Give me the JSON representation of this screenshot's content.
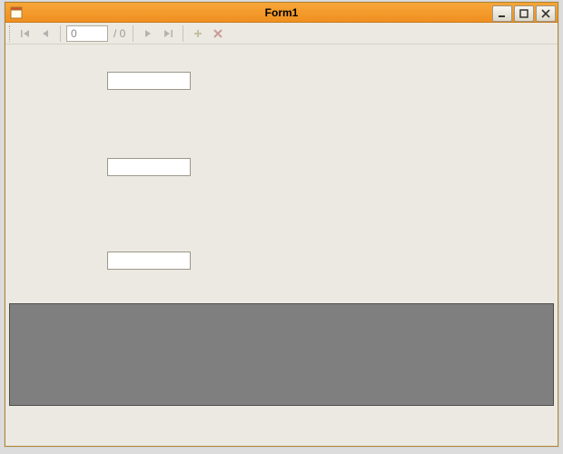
{
  "window": {
    "title": "Form1"
  },
  "navigator": {
    "position": "0",
    "total": "/ 0"
  },
  "fields": {
    "input1": "",
    "input2": "",
    "input3": ""
  }
}
